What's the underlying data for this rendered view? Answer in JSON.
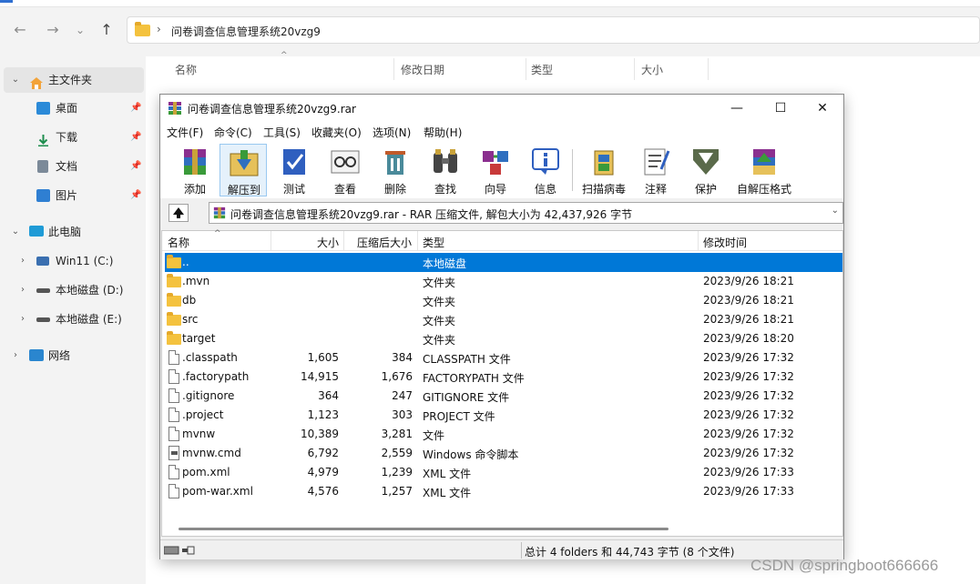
{
  "explorer": {
    "nav": {
      "back": "←",
      "forward": "→",
      "recent": "⌄",
      "up": "↑"
    },
    "address": {
      "chevron": "›",
      "path": "问卷调查信息管理系统20vzg9"
    },
    "sidebar": [
      {
        "label": "主文件夹",
        "arrow": "⌄"
      },
      {
        "label": "桌面",
        "pin": "📌"
      },
      {
        "label": "下载",
        "pin": "📌"
      },
      {
        "label": "文档",
        "pin": "📌"
      },
      {
        "label": "图片",
        "pin": "📌"
      },
      {
        "label": "此电脑",
        "arrow": "⌄"
      },
      {
        "label": "Win11 (C:)",
        "arrow": "›"
      },
      {
        "label": "本地磁盘 (D:)",
        "arrow": "›"
      },
      {
        "label": "本地磁盘 (E:)",
        "arrow": "›"
      },
      {
        "label": "网络",
        "arrow": "›"
      }
    ],
    "columns": {
      "name": "名称",
      "modified": "修改日期",
      "type": "类型",
      "size": "大小"
    }
  },
  "rar": {
    "title": "问卷调查信息管理系统20vzg9.rar",
    "controls": {
      "minimize": "—",
      "maximize": "☐",
      "close": "✕"
    },
    "menu": [
      "文件(F)",
      "命令(C)",
      "工具(S)",
      "收藏夹(O)",
      "选项(N)",
      "帮助(H)"
    ],
    "toolbar": [
      "添加",
      "解压到",
      "测试",
      "查看",
      "删除",
      "查找",
      "向导",
      "信息",
      "扫描病毒",
      "注释",
      "保护",
      "自解压格式"
    ],
    "path_info": "问卷调查信息管理系统20vzg9.rar - RAR 压缩文件, 解包大小为 42,437,926 字节",
    "path_dropdown": "⌄",
    "sort_caret": "^",
    "columns": {
      "name": "名称",
      "size": "大小",
      "packed": "压缩后大小",
      "type": "类型",
      "modified": "修改时间"
    },
    "files": [
      {
        "name": "..",
        "size": "",
        "packed": "",
        "type": "本地磁盘",
        "modified": "",
        "icon": "folder"
      },
      {
        "name": ".mvn",
        "size": "",
        "packed": "",
        "type": "文件夹",
        "modified": "2023/9/26 18:21",
        "icon": "folder"
      },
      {
        "name": "db",
        "size": "",
        "packed": "",
        "type": "文件夹",
        "modified": "2023/9/26 18:21",
        "icon": "folder"
      },
      {
        "name": "src",
        "size": "",
        "packed": "",
        "type": "文件夹",
        "modified": "2023/9/26 18:21",
        "icon": "folder"
      },
      {
        "name": "target",
        "size": "",
        "packed": "",
        "type": "文件夹",
        "modified": "2023/9/26 18:20",
        "icon": "folder"
      },
      {
        "name": ".classpath",
        "size": "1,605",
        "packed": "384",
        "type": "CLASSPATH 文件",
        "modified": "2023/9/26 17:32",
        "icon": "file"
      },
      {
        "name": ".factorypath",
        "size": "14,915",
        "packed": "1,676",
        "type": "FACTORYPATH 文件",
        "modified": "2023/9/26 17:32",
        "icon": "file"
      },
      {
        "name": ".gitignore",
        "size": "364",
        "packed": "247",
        "type": "GITIGNORE 文件",
        "modified": "2023/9/26 17:32",
        "icon": "file"
      },
      {
        "name": ".project",
        "size": "1,123",
        "packed": "303",
        "type": "PROJECT 文件",
        "modified": "2023/9/26 17:32",
        "icon": "file"
      },
      {
        "name": "mvnw",
        "size": "10,389",
        "packed": "3,281",
        "type": "文件",
        "modified": "2023/9/26 17:32",
        "icon": "file"
      },
      {
        "name": "mvnw.cmd",
        "size": "6,792",
        "packed": "2,559",
        "type": "Windows 命令脚本",
        "modified": "2023/9/26 17:32",
        "icon": "cmd"
      },
      {
        "name": "pom.xml",
        "size": "4,979",
        "packed": "1,239",
        "type": "XML 文件",
        "modified": "2023/9/26 17:33",
        "icon": "file"
      },
      {
        "name": "pom-war.xml",
        "size": "4,576",
        "packed": "1,257",
        "type": "XML 文件",
        "modified": "2023/9/26 17:33",
        "icon": "file"
      }
    ],
    "status": "总计 4 folders 和 44,743 字节 (8 个文件)"
  },
  "watermark": "CSDN @springboot666666"
}
